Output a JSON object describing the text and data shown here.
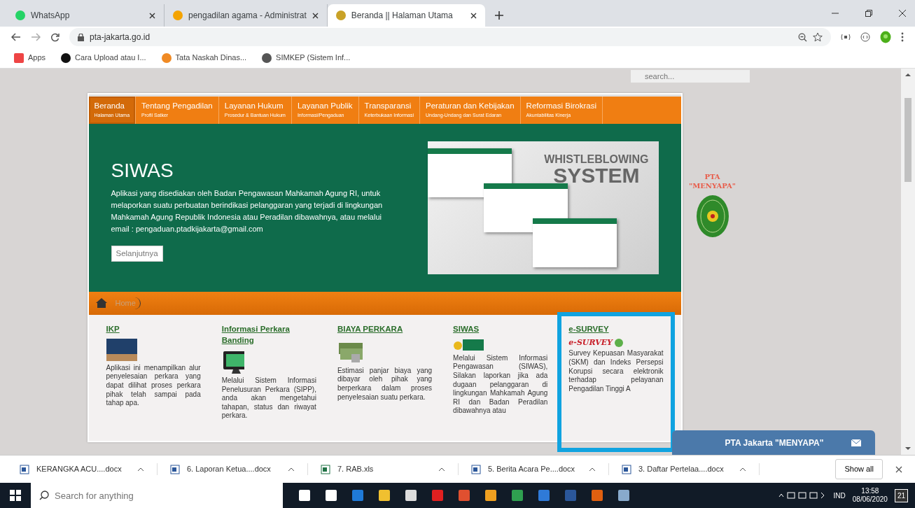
{
  "browser": {
    "tabs": [
      {
        "title": "WhatsApp",
        "selected": false,
        "color": "#25d366"
      },
      {
        "title": "pengadilan agama - Administrat",
        "selected": false,
        "color": "#f4a300"
      },
      {
        "title": "Beranda || Halaman Utama",
        "selected": true,
        "color": "#c9a227"
      }
    ],
    "url": "pta-jakarta.go.id",
    "bookmarks": [
      {
        "label": "Apps",
        "color": "#e44"
      },
      {
        "label": "Cara Upload atau I...",
        "color": "#111111"
      },
      {
        "label": "Tata Naskah Dinas...",
        "color": "#f08a24"
      },
      {
        "label": "SIMKEP (Sistem Inf...",
        "color": "#555555"
      }
    ]
  },
  "page": {
    "search": {
      "placeholder": "search..."
    },
    "nav": [
      {
        "title": "Beranda",
        "subtitle": "Halaman Utama",
        "selected": true
      },
      {
        "title": "Tentang Pengadilan",
        "subtitle": "Profil Satker",
        "selected": false
      },
      {
        "title": "Layanan Hukum",
        "subtitle": "Prosedur & Bantuan Hukum",
        "selected": false
      },
      {
        "title": "Layanan Publik",
        "subtitle": "Informasi/Pengaduan",
        "selected": false
      },
      {
        "title": "Transparansi",
        "subtitle": "Keterbukaan Informasi",
        "selected": false
      },
      {
        "title": "Peraturan dan Kebijakan",
        "subtitle": "Undang-Undang dan Surat Edaran",
        "selected": false
      },
      {
        "title": "Reformasi Birokrasi",
        "subtitle": "Akuntabilitas Kinerja",
        "selected": false
      }
    ],
    "hero": {
      "title": "SIWAS",
      "text": "Aplikasi yang disediakan oleh Badan Pengawasan Mahkamah Agung RI, untuk melaporkan suatu perbuatan berindikasi pelanggaran yang terjadi di lingkungan Mahkamah Agung Republik Indonesia atau Peradilan dibawahnya, atau melalui email : pengaduan.ptadkijakarta@gmail.com",
      "button": "Selanjutnya",
      "banner_title": [
        "WHISTLEBLOWING",
        "SYSTEM"
      ]
    },
    "breadcrumb": [
      "Home"
    ],
    "columns": [
      {
        "title": "IKP",
        "kind": "photo",
        "text": "Aplikasi ini menampilkan alur penyelesaian perkara yang dapat dilihat proses perkara pihak telah sampai pada tahap apa.",
        "highlighted": false
      },
      {
        "title": "Informasi Perkara Banding",
        "kind": "monitor",
        "text": "Melalui Sistem Informasi Penelusuran Perkara (SIPP), anda akan mengetahui tahapan, status dan riwayat perkara.",
        "highlighted": false
      },
      {
        "title": "BIAYA PERKARA",
        "kind": "money",
        "text": "Estimasi panjar biaya yang dibayar oleh pihak yang berperkara dalam proses penyelesaian suatu perkara.",
        "highlighted": false
      },
      {
        "title": "SIWAS",
        "kind": "siwas",
        "text": "Melalui Sistem Informasi Pengawasan (SIWAS), Silakan laporkan jika ada dugaan pelanggaran di lingkungan Mahkamah Agung RI dan Badan Peradilan dibawahnya atau",
        "highlighted": false
      },
      {
        "title": "e-SURVEY",
        "kind": "survey",
        "logo_text": "e-SURVEY",
        "text": "Survey Kepuasan Masyarakat (SKM) dan Indeks Persepsi Korupsi secara elektronik terhadap pelayanan Pengadilan Tinggi A",
        "highlighted": true
      }
    ],
    "side_title": [
      "PTA",
      "\"MENYAPA\""
    ],
    "chat": "PTA Jakarta \"MENYAPA\""
  },
  "downloads": {
    "items": [
      {
        "name": "KERANGKA ACU....docx",
        "kind": "doc"
      },
      {
        "name": "6. Laporan Ketua....docx",
        "kind": "doc"
      },
      {
        "name": "7. RAB.xls",
        "kind": "xls"
      },
      {
        "name": "5. Berita Acara Pe....docx",
        "kind": "doc"
      },
      {
        "name": "3. Daftar Pertelaa....docx",
        "kind": "doc"
      }
    ],
    "show_all": "Show all"
  },
  "taskbar": {
    "search_placeholder": "Search for anything",
    "language": "IND",
    "time": "13:58",
    "date": "08/06/2020",
    "notifications": "21"
  }
}
